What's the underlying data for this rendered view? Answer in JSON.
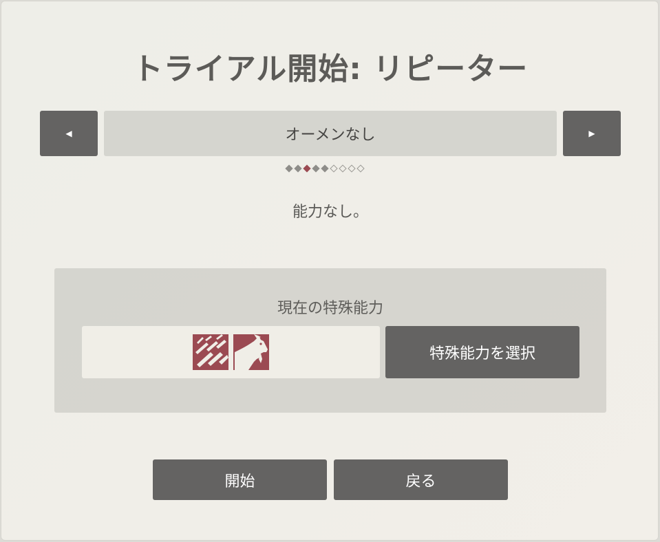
{
  "title": "トライアル開始: リピーター",
  "omen": {
    "prev_glyph": "◀",
    "next_glyph": "▶",
    "selected": "オーメンなし",
    "pager": [
      "filled",
      "filled",
      "active",
      "filled",
      "filled",
      "empty",
      "empty",
      "empty",
      "empty"
    ],
    "description": "能力なし。"
  },
  "abilities": {
    "label": "現在の特殊能力",
    "icons": [
      "rain-streaks-icon",
      "goat-icon"
    ],
    "icon_color": "#9b4a52",
    "select_label": "特殊能力を選択"
  },
  "actions": {
    "start_label": "開始",
    "back_label": "戻る"
  }
}
